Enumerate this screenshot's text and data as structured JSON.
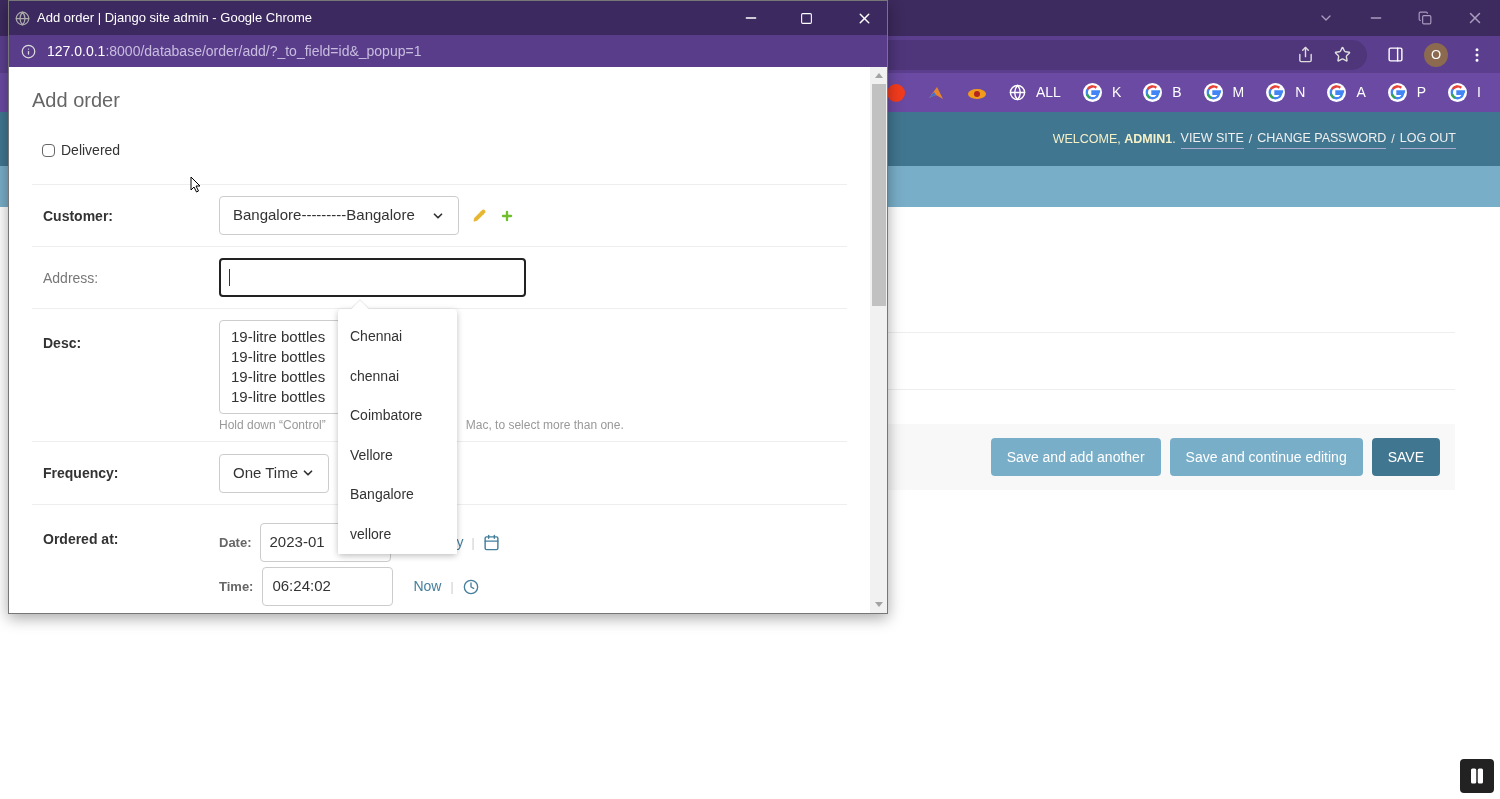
{
  "background": {
    "bookmarks": [
      {
        "kind": "yandex"
      },
      {
        "kind": "triangle"
      },
      {
        "kind": "eye"
      },
      {
        "kind": "globe",
        "label": "ALL"
      },
      {
        "kind": "g",
        "label": "K"
      },
      {
        "kind": "g",
        "label": "B"
      },
      {
        "kind": "g",
        "label": "M"
      },
      {
        "kind": "g",
        "label": "N"
      },
      {
        "kind": "g",
        "label": "A"
      },
      {
        "kind": "g",
        "label": "P"
      },
      {
        "kind": "g",
        "label": "I"
      }
    ],
    "avatar": "O",
    "header": {
      "welcome": "WELCOME, **ADMIN1**.",
      "links": [
        "VIEW SITE",
        "CHANGE PASSWORD",
        "LOG OUT"
      ],
      "separator": "/"
    },
    "buttons": [
      {
        "label": "Save and add another",
        "kind": "secondary"
      },
      {
        "label": "Save and continue editing",
        "kind": "secondary"
      },
      {
        "label": "SAVE",
        "kind": "primary"
      }
    ]
  },
  "popup": {
    "title": "Add order | Django site admin - Google Chrome",
    "url_host": "127.0.0.1",
    "url_path": ":8000/database/order/add/?_to_field=id&_popup=1",
    "heading": "Add order",
    "delivered": {
      "label": "Delivered",
      "checked": false
    },
    "customer": {
      "label": "Customer:",
      "value": "Bangalore---------Bangalore"
    },
    "address": {
      "label": "Address:"
    },
    "desc": {
      "label": "Desc:",
      "options": [
        "19-litre bottles",
        "19-litre bottles",
        "19-litre bottles",
        "19-litre bottles"
      ],
      "help_left": "Hold down “Control”",
      "help_right": "Mac, to select more than one."
    },
    "frequency": {
      "label": "Frequency:",
      "value": "One Time"
    },
    "ordered_at": {
      "label": "Ordered at:",
      "date_label": "Date:",
      "date_value": "2023-01",
      "today_fragment": "y",
      "time_label": "Time:",
      "time_value": "06:24:02",
      "now": "Now",
      "sep": "|"
    },
    "suggestions": [
      {
        "text": "Chennai",
        "selected": false
      },
      {
        "text": "chennai",
        "selected": false
      },
      {
        "text": "Coimbatore",
        "selected": false
      },
      {
        "text": "Vellore",
        "selected": false
      },
      {
        "text": "Bangalore",
        "selected": false
      },
      {
        "text": "vellore",
        "selected": false
      }
    ]
  }
}
